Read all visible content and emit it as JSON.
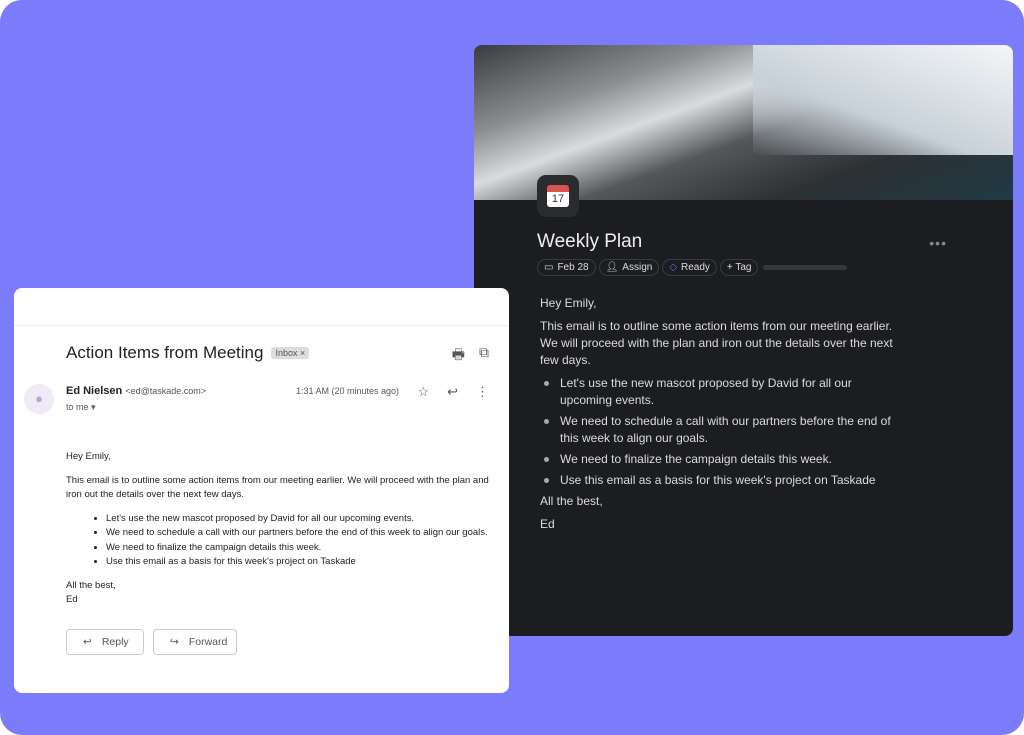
{
  "colors": {
    "background": "#7b7cfb",
    "dark_panel": "#1c1d20",
    "tag_icon": "#6b6ef0"
  },
  "taskade": {
    "title": "Weekly Plan",
    "more_icon": "ellipsis-icon",
    "chips": {
      "date": "Feb 28",
      "assign": "Assign",
      "status": "Ready",
      "tag": "+ Tag"
    },
    "greeting": "Hey Emily,",
    "intro": "This email is to outline some action items from our meeting earlier. We will proceed with the plan and iron out the details over the next few days.",
    "items": [
      "Let's use the new mascot proposed by David for all our upcoming events.",
      "We need to schedule a call with our partners before the end of this week to align our goals.",
      "We need to finalize the campaign details this week.",
      "Use this email as a basis for this week's project on Taskade"
    ],
    "signoff": "All the best,",
    "signature": "Ed"
  },
  "gmail": {
    "subject": "Action Items from Meeting",
    "label": "Inbox ×",
    "sender_name": "Ed Nielsen",
    "sender_email": "<ed@taskade.com>",
    "recipient": "to me ▾",
    "time": "1:31 AM (20 minutes ago)",
    "greeting": "Hey Emily,",
    "intro": "This email is to outline some action items from our meeting earlier. We will proceed with the plan and iron out the details over the next few days.",
    "items": [
      "Let's use the new mascot proposed by David for all our upcoming events.",
      "We need to schedule a call with our partners before the end of this week to align our goals.",
      "We need to finalize the campaign details this week.",
      "Use this email as a basis for this week's project on Taskade"
    ],
    "signoff": "All the best,",
    "signature": "Ed",
    "reply_label": "Reply",
    "forward_label": "Forward"
  }
}
